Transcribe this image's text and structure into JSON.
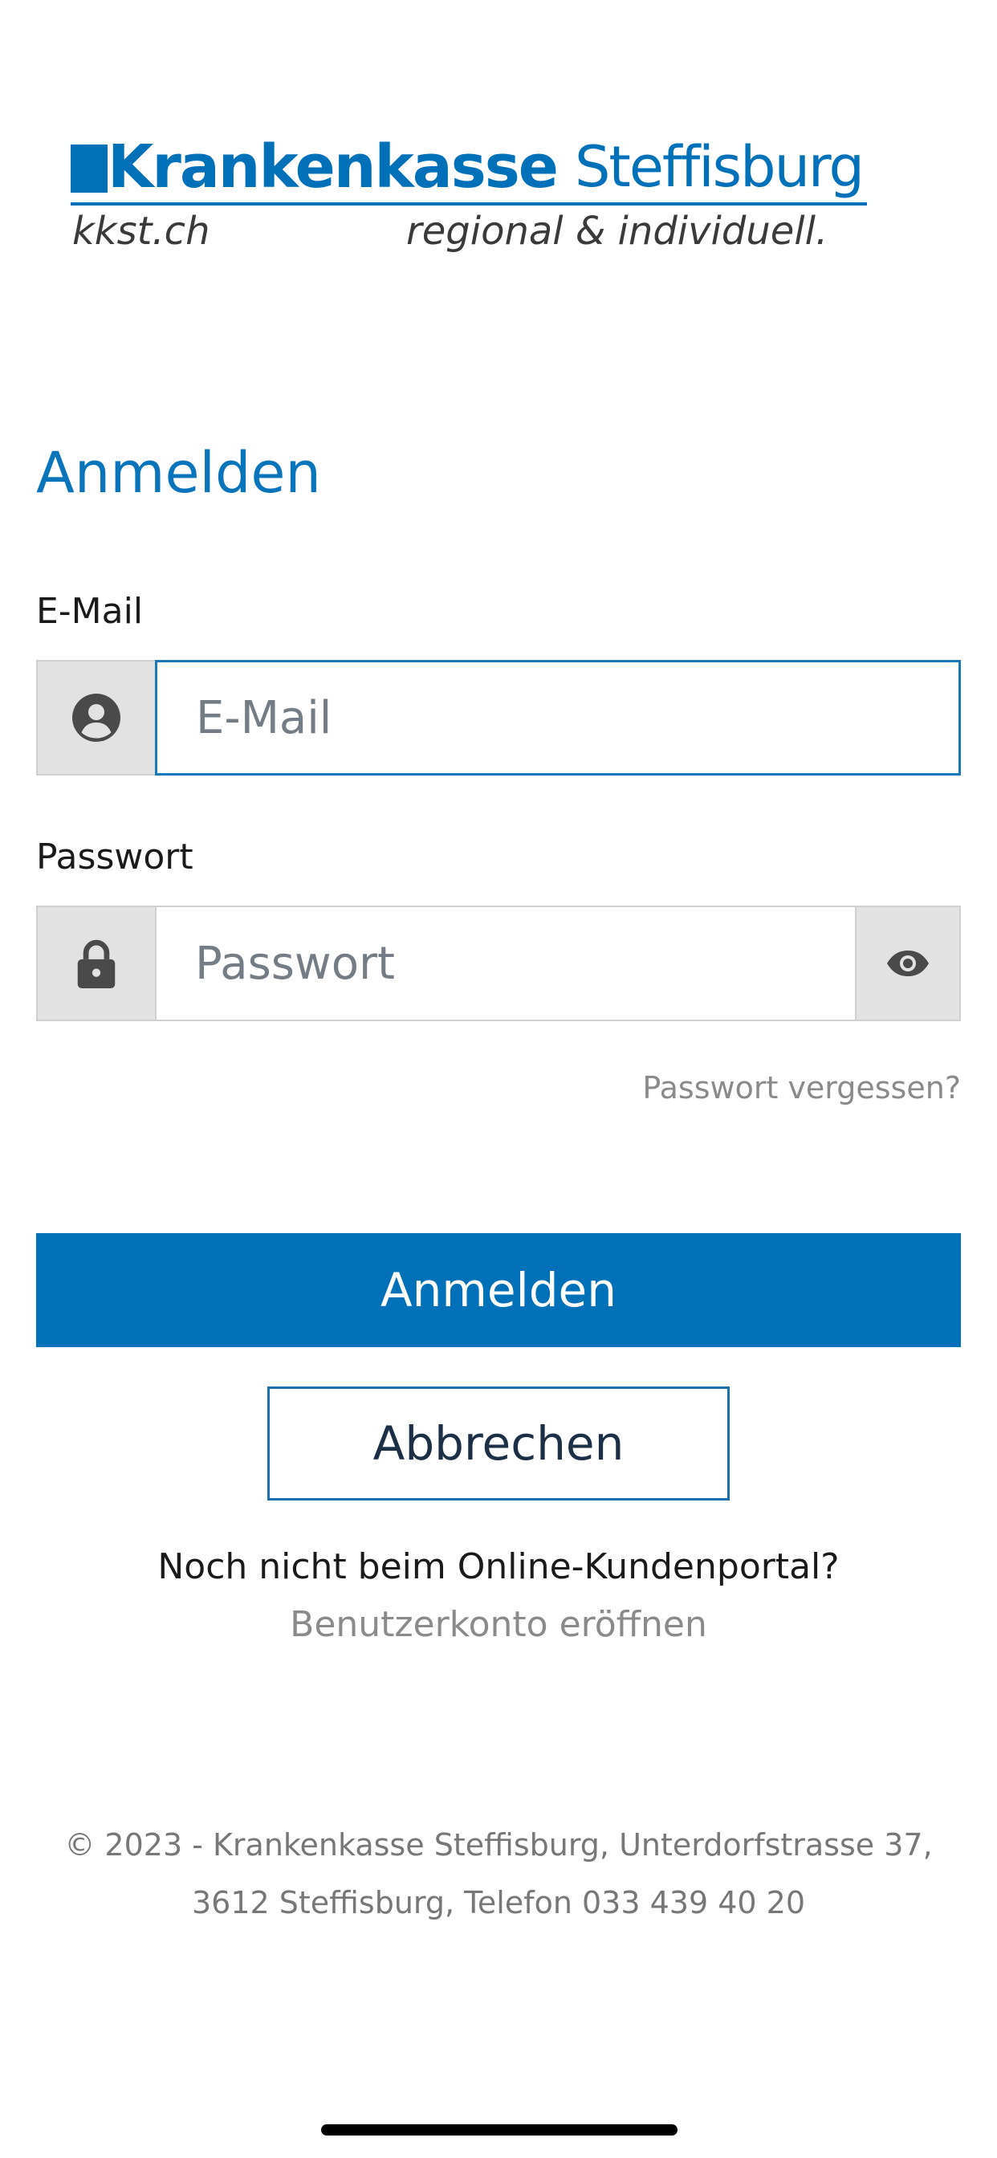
{
  "logo": {
    "brand": "Krankenkasse",
    "brand_suffix": "Steffisburg",
    "domain": "kkst.ch",
    "tagline": "regional & individuell."
  },
  "title": "Anmelden",
  "email": {
    "label": "E-Mail",
    "placeholder": "E-Mail",
    "icon": "user-circle-icon"
  },
  "password": {
    "label": "Passwort",
    "placeholder": "Passwort",
    "icon": "lock-icon",
    "toggle_icon": "eye-icon"
  },
  "forgot_password": "Passwort vergessen?",
  "login_button": "Anmelden",
  "cancel_button": "Abbrechen",
  "register": {
    "question": "Noch nicht beim Online-Kundenportal?",
    "link": "Benutzerkonto eröffnen"
  },
  "footer": "© 2023 - Krankenkasse Steffisburg, Unterdorfstrasse 37, 3612 Steffisburg, Telefon 033 439 40 20",
  "colors": {
    "primary": "#0070b8",
    "title": "#0a74bb",
    "addon_bg": "#e2e2e2"
  }
}
